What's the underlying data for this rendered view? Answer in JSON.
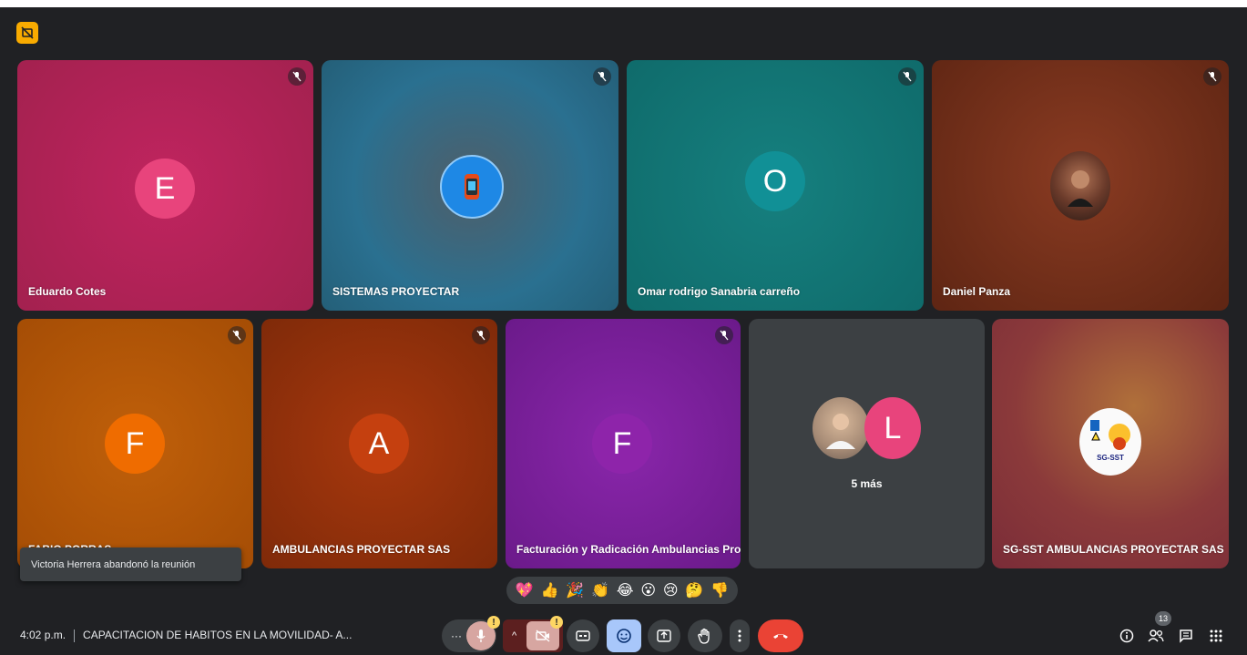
{
  "participants": [
    {
      "name": "Eduardo Cotes",
      "initial": "E",
      "tile_color": "#b32159",
      "avatar_color": "#e8447c"
    },
    {
      "name": "SISTEMAS PROYECTAR",
      "avatar_icon": "smartwatch-app-icon",
      "tile_color": "#2f6d86"
    },
    {
      "name": "Omar rodrigo Sanabria carreño",
      "initial": "O",
      "tile_color": "#127c7b",
      "avatar_color": "#119096"
    },
    {
      "name": "Daniel Panza",
      "avatar_icon": "user-photo",
      "tile_color": "#6b2c17"
    },
    {
      "name": "FABIO PORRAS",
      "initial": "F",
      "tile_color": "#b35606",
      "avatar_color": "#ef6c00"
    },
    {
      "name": "AMBULANCIAS PROYECTAR SAS",
      "initial": "A",
      "tile_color": "#8e2f0b",
      "avatar_color": "#c5400f"
    },
    {
      "name": "Facturación y Radicación Ambulancias Pro...",
      "initial": "F",
      "tile_color": "#7a1f9c",
      "avatar_color": "#8e24aa"
    },
    {
      "name": "5 más",
      "initial": "L",
      "tile_color": "#3c4043",
      "avatar_color": "#e8447c"
    },
    {
      "name": "SG-SST AMBULANCIAS PROYECTAR SAS",
      "avatar_icon": "sg-sst-logo",
      "logo_text": "SG-SST",
      "tile_color": "#8b3a3a"
    }
  ],
  "toast": {
    "message": "Victoria Herrera abandonó la reunión"
  },
  "reactions": [
    "💖",
    "👍",
    "🎉",
    "👏",
    "😂",
    "😮",
    "😢",
    "🤔",
    "👎"
  ],
  "meeting": {
    "time": "4:02 p.m.",
    "title": "CAPACITACION DE HABITOS EN LA MOVILIDAD- A..."
  },
  "controls": {
    "more_label": "···",
    "people_count": "13",
    "warn_mark": "!"
  }
}
